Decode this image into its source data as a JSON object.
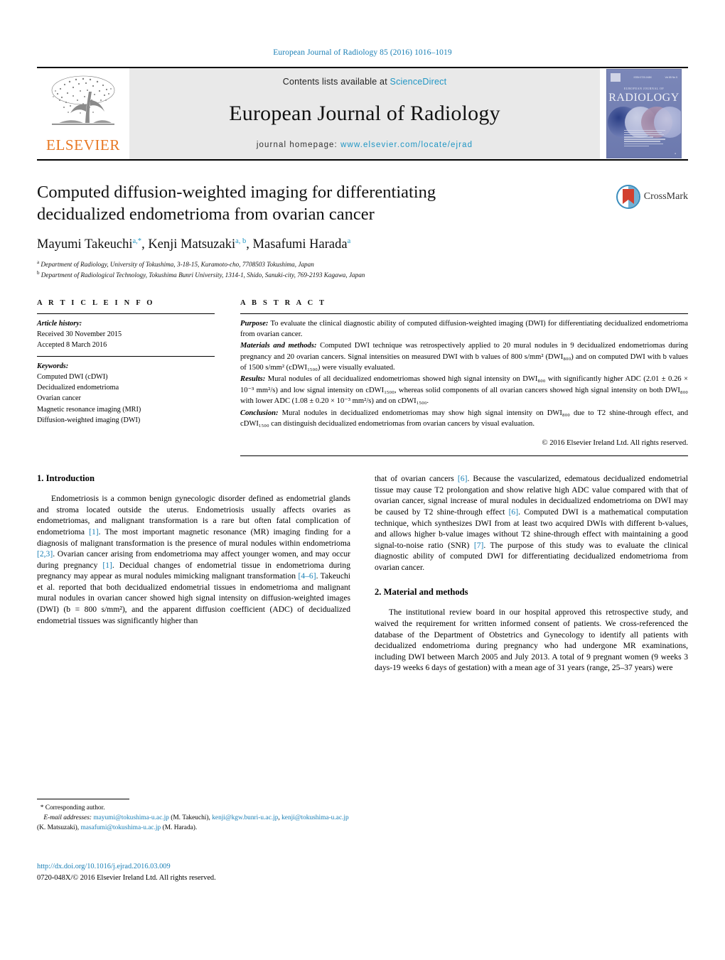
{
  "running_head": "European Journal of Radiology 85 (2016) 1016–1019",
  "masthead": {
    "contents_prefix": "Contents lists available at ",
    "sciencedirect": "ScienceDirect",
    "journal_title": "European Journal of Radiology",
    "homepage_prefix": "journal homepage: ",
    "homepage_url": "www.elsevier.com/locate/ejrad",
    "publisher_wordmark": "ELSEVIER",
    "cover": {
      "masthead_small": "EUROPEAN JOURNAL OF",
      "title": "RADIOLOGY",
      "top_left_text": "ISSN 0720-048X",
      "top_right_text": "Vol 85 No 5"
    },
    "link_color": "#2196c4"
  },
  "article": {
    "title": "Computed diffusion-weighted imaging for differentiating decidualized endometrioma from ovarian cancer",
    "authors_html": "Mayumi Takeuchi<sup>a,*</sup>, Kenji Matsuzaki<sup>a, b</sup>, Masafumi Harada<sup>a</sup>",
    "affiliations": [
      "Department of Radiology, University of Tokushima, 3-18-15, Kuramoto-cho, 7708503 Tokushima, Japan",
      "Department of Radiological Technology, Tokushima Bunri University, 1314-1, Shido, Sanuki-city, 769-2193 Kagawa, Japan"
    ],
    "affiliation_marks": [
      "a",
      "b"
    ],
    "crossmark_label": "CrossMark"
  },
  "article_info": {
    "heading": "A R T I C L E   I N F O",
    "history_label": "Article history:",
    "history": [
      "Received 30 November 2015",
      "Accepted 8 March 2016"
    ],
    "keywords_label": "Keywords:",
    "keywords": [
      "Computed DWI (cDWI)",
      "Decidualized endometrioma",
      "Ovarian cancer",
      "Magnetic resonance imaging (MRI)",
      "Diffusion-weighted imaging (DWI)"
    ]
  },
  "abstract": {
    "heading": "A B S T R A C T",
    "purpose_label": "Purpose:",
    "purpose_text": " To evaluate the clinical diagnostic ability of computed diffusion-weighted imaging (DWI) for differentiating decidualized endometrioma from ovarian cancer.",
    "methods_label": "Materials and methods:",
    "methods_text": " Computed DWI technique was retrospectively applied to 20 mural nodules in 9 decidualized endometriomas during pregnancy and 20 ovarian cancers. Signal intensities on measured DWI with b values of 800 s/mm² (DWI₈₀₀) and on computed DWI with b values of 1500 s/mm² (cDWI₁₅₀₀) were visually evaluated.",
    "results_label": "Results:",
    "results_text": " Mural nodules of all decidualized endometriomas showed high signal intensity on DWI₈₀₀ with significantly higher ADC (2.01 ± 0.26 × 10⁻³ mm²/s) and low signal intensity on cDWI₁₅₀₀, whereas solid components of all ovarian cancers showed high signal intensity on both DWI₈₀₀ with lower ADC (1.08 ± 0.20 × 10⁻³ mm²/s) and on cDWI₁₅₀₀.",
    "conclusion_label": "Conclusion:",
    "conclusion_text": " Mural nodules in decidualized endometriomas may show high signal intensity on DWI₈₀₀ due to T2 shine-through effect, and cDWI₁₅₀₀ can distinguish decidualized endometriomas from ovarian cancers by visual evaluation.",
    "copyright": "© 2016 Elsevier Ireland Ltd. All rights reserved."
  },
  "sections": {
    "intro_heading": "1.  Introduction",
    "intro_p1_a": "Endometriosis is a common benign gynecologic disorder defined as endometrial glands and stroma located outside the uterus. Endometriosis usually affects ovaries as endometriomas, and malignant transformation is a rare but often fatal complication of endometrioma ",
    "ref1": "[1]",
    "intro_p1_b": ". The most important magnetic resonance (MR) imaging finding for a diagnosis of malignant transformation is the presence of mural nodules within endometrioma ",
    "ref23": "[2,3]",
    "intro_p1_c": ". Ovarian cancer arising from endometrioma may affect younger women, and may occur during pregnancy ",
    "ref1b": "[1]",
    "intro_p1_d": ". Decidual changes of endometrial tissue in endometrioma during pregnancy may appear as mural nodules mimicking malignant transformation ",
    "ref46": "[4–6]",
    "intro_p1_e": ". Takeuchi et al. reported that both decidualized endometrial tissues in endometrioma and malignant mural nodules in ovarian cancer showed high signal intensity on diffusion-weighted images (DWI) (b = 800 s/mm²), and the apparent diffusion coefficient (ADC) of decidualized endometrial tissues was significantly higher than",
    "intro_p1_f": "that of ovarian cancers ",
    "ref6": "[6]",
    "intro_p1_g": ". Because the vascularized, edematous decidualized endometrial tissue may cause T2 prolongation and show relative high ADC value compared with that of ovarian cancer, signal increase of mural nodules in decidualized endometrioma on DWI may be caused by T2 shine-through effect ",
    "ref6b": "[6]",
    "intro_p1_h": ". Computed DWI is a mathematical computation technique, which synthesizes DWI from at least two acquired DWIs with different b-values, and allows higher b-value images without T2 shine-through effect with maintaining a good signal-to-noise ratio (SNR) ",
    "ref7": "[7]",
    "intro_p1_i": ". The purpose of this study was to evaluate the clinical diagnostic ability of computed DWI for differentiating decidualized endometrioma from ovarian cancer.",
    "methods_heading": "2.  Material and methods",
    "methods_p1": "The institutional review board in our hospital approved this retrospective study, and waived the requirement for written informed consent of patients. We cross-referenced the database of the Department of Obstetrics and Gynecology to identify all patients with decidualized endometrioma during pregnancy who had undergone MR examinations, including DWI between March 2005 and July 2013. A total of 9 pregnant women (9 weeks 3 days-19 weeks 6 days of gestation) with a mean age of 31 years (range, 25–37 years) were"
  },
  "footer": {
    "corresponding_mark": "*",
    "corresponding_text": " Corresponding author.",
    "email_label": "E-mail addresses:",
    "emails": [
      {
        "addr": "mayumi@tokushima-u.ac.jp",
        "name": " (M. Takeuchi), "
      },
      {
        "addr": "kenji@kgw.bunri-u.ac.jp",
        "name": ", "
      },
      {
        "addr": "kenji@tokushima-u.ac.jp",
        "name": " (K. Matsuzaki), "
      },
      {
        "addr": "masafumi@tokushima-u.ac.jp",
        "name": " (M. Harada)."
      }
    ],
    "doi": "http://dx.doi.org/10.1016/j.ejrad.2016.03.009",
    "issn_line": "0720-048X/© 2016 Elsevier Ireland Ltd. All rights reserved."
  }
}
